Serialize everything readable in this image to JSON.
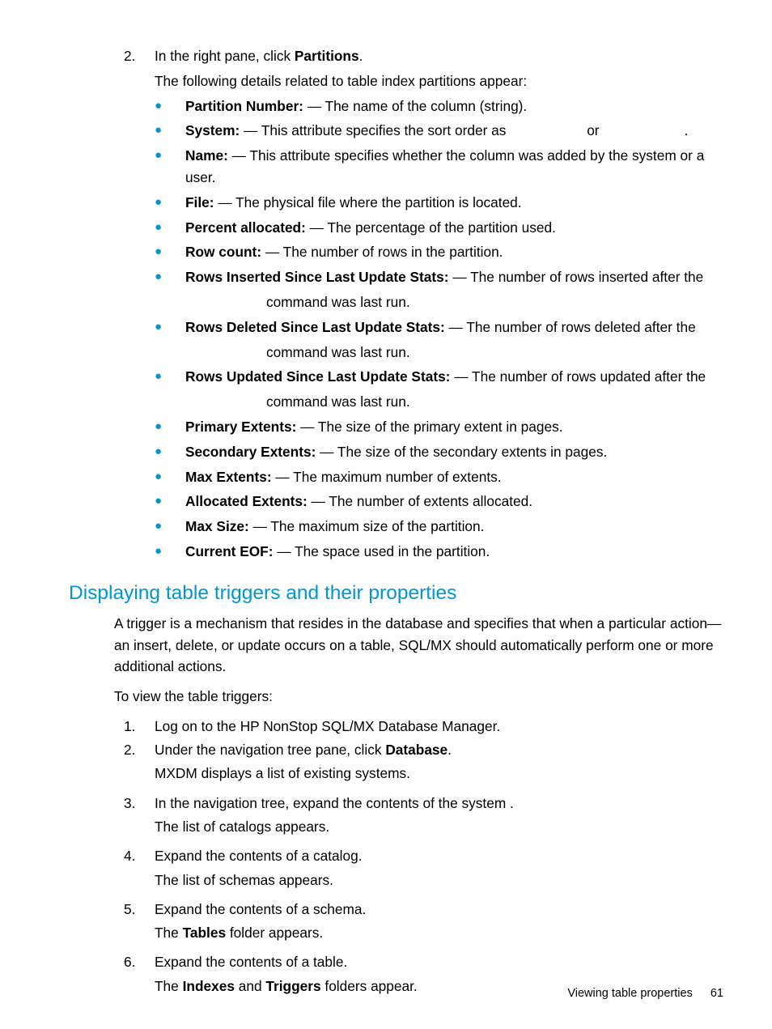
{
  "top": {
    "step_num": "2.",
    "step_text_a": "In the right pane, click ",
    "step_text_b": "Partitions",
    "step_text_c": ".",
    "followup": "The following details related to table index partitions appear:"
  },
  "bullets": [
    {
      "label": "Partition Number:",
      "desc": " — The name of the column (string)."
    },
    {
      "label": "System:",
      "desc_pre": " — This attribute specifies the sort order as ",
      "desc_mid": "or",
      "desc_post": "."
    },
    {
      "label": "Name:",
      "desc": " — This attribute specifies whether the column was added by the system or a user."
    },
    {
      "label": "File:",
      "desc": " — The physical file where the partition is located."
    },
    {
      "label": "Percent allocated:",
      "desc": " — The percentage of the partition used."
    },
    {
      "label": "Row count:",
      "desc": " — The number of rows in the partition."
    },
    {
      "label": "Rows Inserted Since Last Update Stats:",
      "desc": " — The number of rows inserted after the ",
      "cont": "command was last run."
    },
    {
      "label": "Rows Deleted Since Last Update Stats:",
      "desc": " — The number of rows deleted after the ",
      "cont": "command was last run."
    },
    {
      "label": "Rows Updated Since Last Update Stats:",
      "desc": " — The number of rows updated after the ",
      "cont": "command was last run."
    },
    {
      "label": "Primary Extents:",
      "desc": " — The size of the primary extent in pages."
    },
    {
      "label": "Secondary Extents:",
      "desc": " — The size of the secondary extents in pages."
    },
    {
      "label": "Max Extents:",
      "desc": " — The maximum number of extents."
    },
    {
      "label": "Allocated Extents:",
      "desc": " — The number of extents allocated."
    },
    {
      "label": "Max Size:",
      "desc": " — The maximum size of the partition."
    },
    {
      "label": "Current EOF:",
      "desc": " — The space used in the partition."
    }
  ],
  "section_heading": "Displaying table triggers and their properties",
  "section_intro": "A trigger is a mechanism that resides in the database and specifies that when a particular action—an insert, delete, or update occurs on a table, SQL/MX should automatically perform one or more additional actions.",
  "section_lead": "To view the table triggers:",
  "steps": [
    {
      "num": "1.",
      "text": "Log on to the HP NonStop SQL/MX Database Manager."
    },
    {
      "num": "2.",
      "text_a": "Under the navigation tree pane, click ",
      "bold": "Database",
      "text_b": ".",
      "follow": "MXDM displays a list of existing systems."
    },
    {
      "num": "3.",
      "text": "In the navigation tree, expand the contents of the system .",
      "follow": "The list of catalogs appears."
    },
    {
      "num": "4.",
      "text": "Expand the contents of a catalog.",
      "follow": "The list of schemas appears."
    },
    {
      "num": "5.",
      "text": "Expand the contents of a schema.",
      "follow_a": "The ",
      "follow_b1": "Tables",
      "follow_c": " folder appears."
    },
    {
      "num": "6.",
      "text": "Expand the contents of a table.",
      "follow_a": "The ",
      "follow_b1": "Indexes",
      "follow_mid": " and ",
      "follow_b2": "Triggers",
      "follow_c": " folders appear."
    }
  ],
  "footer": {
    "text": "Viewing table properties",
    "page": "61"
  }
}
